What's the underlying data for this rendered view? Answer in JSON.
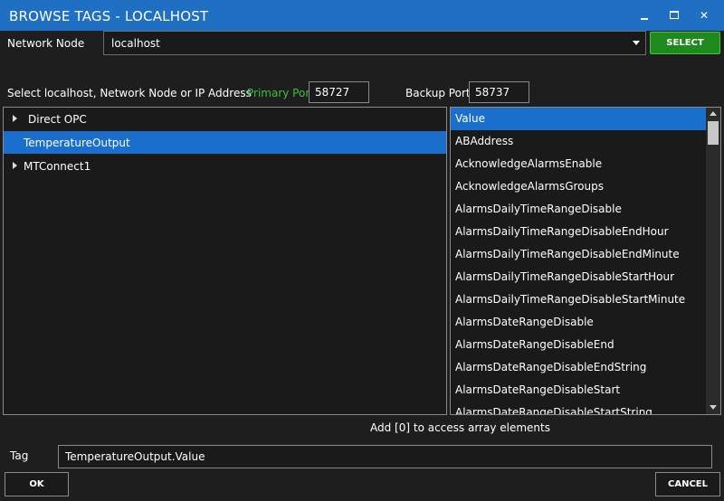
{
  "window": {
    "title": "BROWSE TAGS - LOCALHOST",
    "minimize_icon": "minimize-icon",
    "maximize_icon": "maximize-icon",
    "close_glyph": "✕"
  },
  "network_node": {
    "label": "Network Node",
    "value": "localhost",
    "select_button": "SELECT"
  },
  "hint": "Select localhost, Network Node or IP Address",
  "ports": {
    "primary_label": "Primary Port",
    "primary_value": "58727",
    "backup_label": "Backup Port",
    "backup_value": "58737"
  },
  "tree": {
    "items": [
      {
        "label": "Direct OPC",
        "expandable": true
      },
      {
        "label": "TemperatureOutput",
        "expandable": false,
        "selected": true
      },
      {
        "label": "MTConnect1",
        "expandable": true
      }
    ]
  },
  "properties": {
    "items": [
      "Value",
      "ABAddress",
      "AcknowledgeAlarmsEnable",
      "AcknowledgeAlarmsGroups",
      "AlarmsDailyTimeRangeDisable",
      "AlarmsDailyTimeRangeDisableEndHour",
      "AlarmsDailyTimeRangeDisableEndMinute",
      "AlarmsDailyTimeRangeDisableStartHour",
      "AlarmsDailyTimeRangeDisableStartMinute",
      "AlarmsDateRangeDisable",
      "AlarmsDateRangeDisableEnd",
      "AlarmsDateRangeDisableEndString",
      "AlarmsDateRangeDisableStart",
      "AlarmsDateRangeDisableStartString"
    ],
    "selected": "Value"
  },
  "array_hint": "Add [0] to access array elements",
  "tag": {
    "label": "Tag",
    "value": "TemperatureOutput.Value"
  },
  "buttons": {
    "ok": "OK",
    "cancel": "CANCEL"
  },
  "colors": {
    "titlebar": "#1f6fc2",
    "selection": "#1a6fcc",
    "select_button": "#1e8a1e",
    "primary_port_label": "#3fbf3f",
    "background": "#1e1e1e"
  }
}
